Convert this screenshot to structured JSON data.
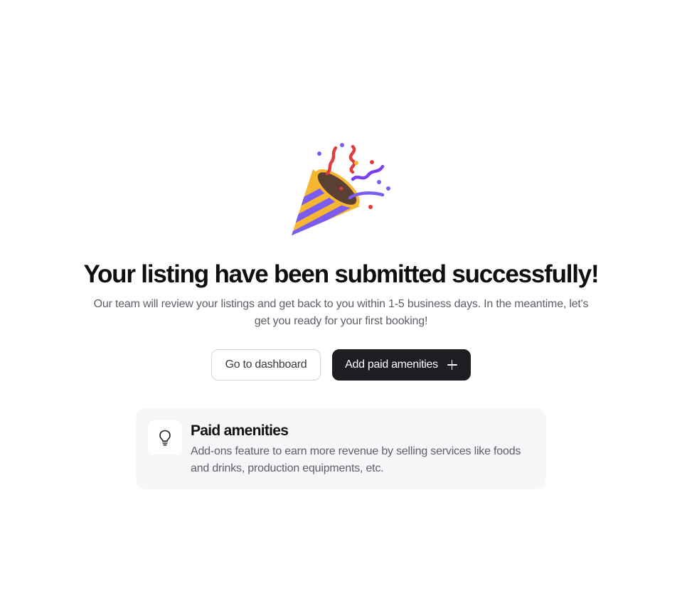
{
  "hero": {
    "icon": "party-popper-icon",
    "title": "Your listing have been submitted successfully!",
    "subtitle": "Our team will review your listings and get back to you within 1-5 business days. In the meantime, let's get you ready for your first booking!"
  },
  "actions": {
    "dashboard_label": "Go to dashboard",
    "add_amenities_label": "Add paid amenities",
    "add_amenities_icon": "plus-icon"
  },
  "info_card": {
    "icon": "lightbulb-icon",
    "title": "Paid amenities",
    "description": "Add-ons feature to earn more revenue by selling services like foods and drinks, production equipments, etc."
  },
  "colors": {
    "primary_button": "#1e1d22",
    "card_background": "#f6f6f8",
    "muted_text": "#5e6068"
  }
}
